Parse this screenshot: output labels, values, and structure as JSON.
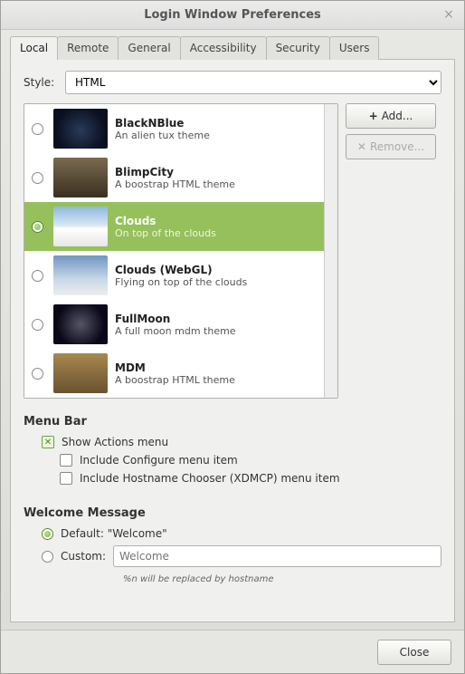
{
  "window": {
    "title": "Login Window Preferences"
  },
  "tabs": [
    "Local",
    "Remote",
    "General",
    "Accessibility",
    "Security",
    "Users"
  ],
  "active_tab": 0,
  "style": {
    "label": "Style:",
    "value": "HTML"
  },
  "themes": [
    {
      "name": "BlackNBlue",
      "desc": "An alien tux theme"
    },
    {
      "name": "BlimpCity",
      "desc": "A boostrap HTML theme"
    },
    {
      "name": "Clouds",
      "desc": "On top of the clouds"
    },
    {
      "name": "Clouds (WebGL)",
      "desc": "Flying on top of the clouds"
    },
    {
      "name": "FullMoon",
      "desc": "A full moon mdm theme"
    },
    {
      "name": "MDM",
      "desc": "A boostrap HTML theme"
    }
  ],
  "selected_theme": 2,
  "buttons": {
    "add": "Add...",
    "remove": "Remove...",
    "close": "Close"
  },
  "menubar": {
    "title": "Menu Bar",
    "show_actions": {
      "label": "Show Actions menu",
      "checked": true
    },
    "include_configure": {
      "label": "Include Configure menu item",
      "checked": false
    },
    "include_hostname": {
      "label": "Include Hostname Chooser (XDMCP) menu item",
      "checked": false
    }
  },
  "welcome": {
    "title": "Welcome Message",
    "default": {
      "label": "Default: \"Welcome\"",
      "selected": true
    },
    "custom": {
      "label": "Custom:",
      "selected": false,
      "placeholder": "Welcome"
    },
    "hint": "%n will be replaced by hostname"
  }
}
